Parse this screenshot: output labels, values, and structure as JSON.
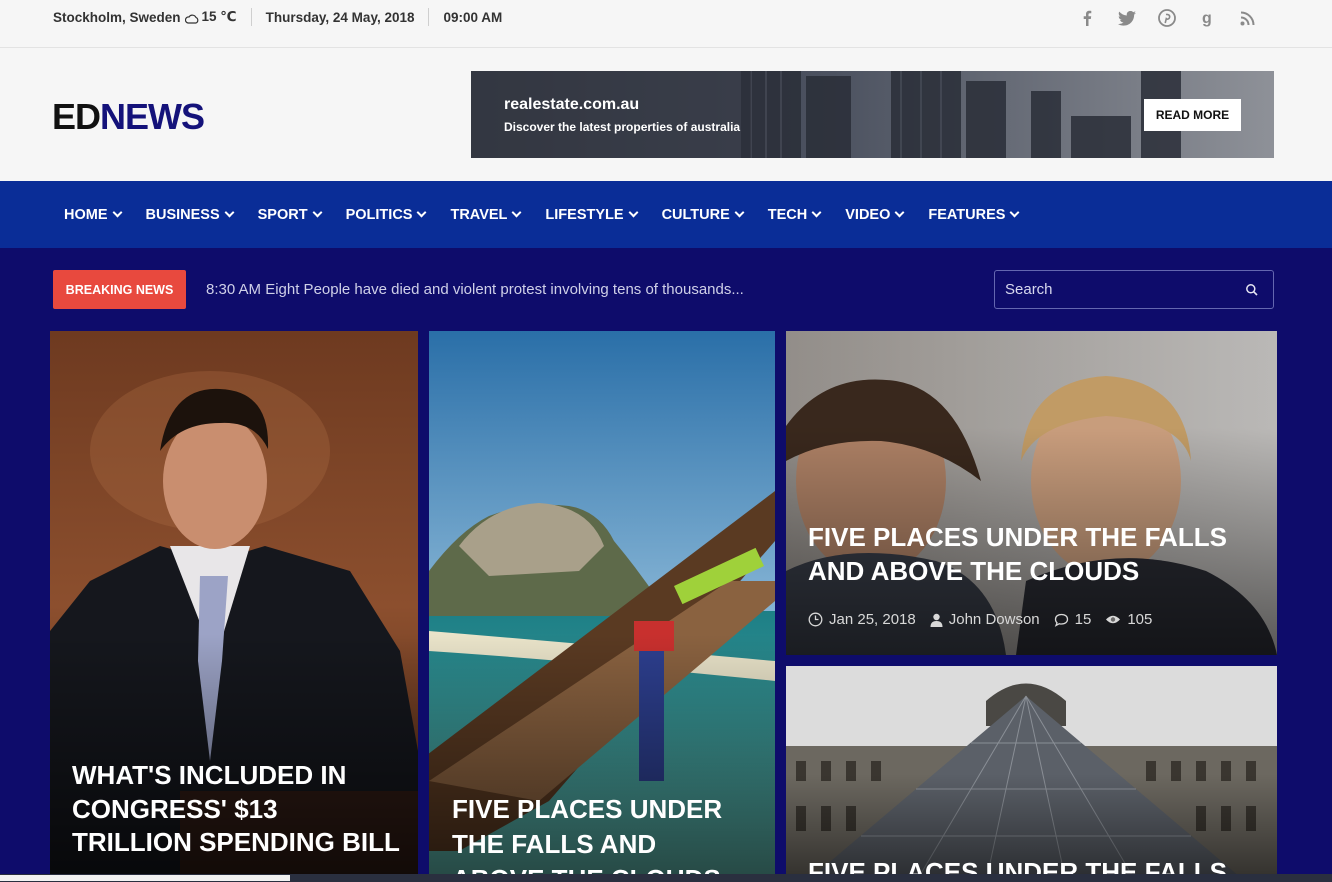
{
  "topbar": {
    "location": "Stockholm, Sweden",
    "temperature": "15 ℃",
    "date": "Thursday, 24 May, 2018",
    "time": "09:00 AM",
    "social": [
      "facebook-icon",
      "twitter-icon",
      "pinterest-icon",
      "google-plus-icon",
      "rss-icon"
    ]
  },
  "header": {
    "logo_ed": "ED",
    "logo_news": "NEWS",
    "ad": {
      "title": "realestate.com.au",
      "subtitle": "Discover the latest properties of australia",
      "button": "READ MORE"
    }
  },
  "nav": {
    "items": [
      "HOME",
      "BUSINESS",
      "SPORT",
      "POLITICS",
      "TRAVEL",
      "LIFESTYLE",
      "CULTURE",
      "TECH",
      "VIDEO",
      "FEATURES"
    ]
  },
  "breaking": {
    "label": "BREAKING NEWS",
    "text": "8:30 AM Eight People have died and violent protest involving tens of thousands..."
  },
  "search": {
    "placeholder": "Search"
  },
  "cards": [
    {
      "title": "WHAT'S INCLUDED IN CONGRESS' $13 TRILLION SPENDING BILL"
    },
    {
      "title": "FIVE PLACES UNDER THE FALLS AND ABOVE THE CLOUDS"
    },
    {
      "title": "FIVE PLACES UNDER THE FALLS AND ABOVE THE CLOUDS",
      "date": "Jan 25, 2018",
      "author": "John Dowson",
      "comments": "15",
      "views": "105"
    },
    {
      "title": "FIVE PLACES UNDER THE FALLS AND ABOVE THE CLOUDS"
    }
  ],
  "colors": {
    "nav": "#0a2d97",
    "body": "#0e0c6b",
    "breaking": "#e8493e",
    "logo_accent": "#14127a"
  }
}
